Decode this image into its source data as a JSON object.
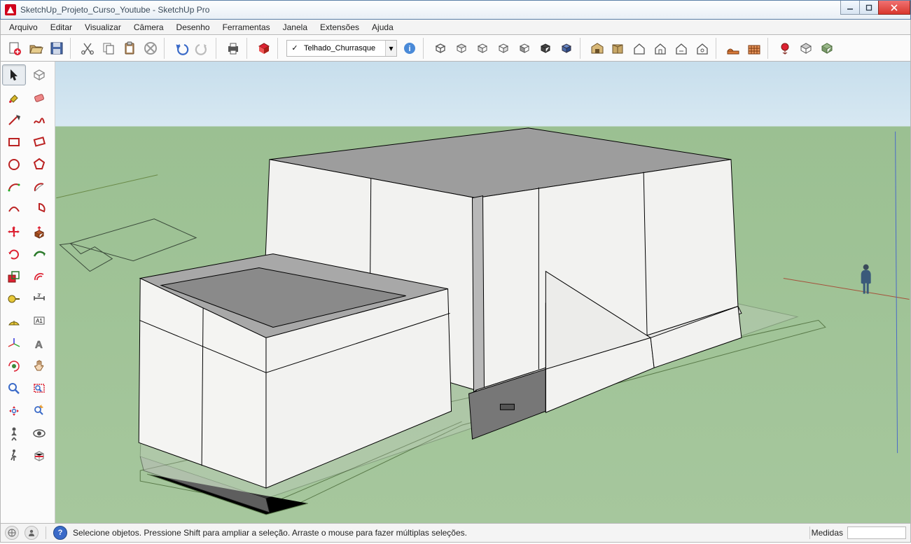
{
  "window": {
    "title": "SketchUp_Projeto_Curso_Youtube - SketchUp Pro"
  },
  "menu": {
    "items": [
      "Arquivo",
      "Editar",
      "Visualizar",
      "Câmera",
      "Desenho",
      "Ferramentas",
      "Janela",
      "Extensões",
      "Ajuda"
    ]
  },
  "layer_dropdown": {
    "value": "Telhado_Churrasque",
    "checked": "✓"
  },
  "status": {
    "hint": "Selecione objetos. Pressione Shift para ampliar a seleção. Arraste o mouse para fazer múltiplas seleções.",
    "measure_label": "Medidas"
  },
  "side_tools": [
    [
      "select-tool",
      "component-tool"
    ],
    [
      "paint-tool",
      "eraser-tool"
    ],
    [
      "line-tool",
      "freehand-tool"
    ],
    [
      "rectangle-tool",
      "rotated-rect-tool"
    ],
    [
      "circle-tool",
      "polygon-tool"
    ],
    [
      "arc-tool",
      "arc2-tool"
    ],
    [
      "arc3-tool",
      "pie-tool"
    ],
    [
      "move-tool",
      "pushpull-tool"
    ],
    [
      "rotate-tool",
      "followme-tool"
    ],
    [
      "scale-tool",
      "offset-tool"
    ],
    [
      "tape-tool",
      "dimension-tool"
    ],
    [
      "protractor-tool",
      "text-tool"
    ],
    [
      "axes-tool",
      "3dtext-tool"
    ],
    [
      "orbit-tool",
      "pan-tool"
    ],
    [
      "zoom-tool",
      "zoomwindow-tool"
    ],
    [
      "zoomextents-tool",
      "previous-tool"
    ],
    [
      "position-camera-tool",
      "lookaround-tool"
    ],
    [
      "walk-tool",
      "section-tool"
    ]
  ],
  "top_toolbar_groups": [
    [
      "new-file",
      "open-file",
      "save-file"
    ],
    [
      "cut",
      "copy",
      "paste",
      "delete"
    ],
    [
      "undo",
      "redo"
    ],
    [
      "print"
    ],
    [
      "model-info"
    ],
    [
      "layer-dropdown",
      "layer-manager"
    ],
    [
      "iso-view",
      "top-view",
      "front-view",
      "right-view",
      "back-view",
      "left-view",
      "shaded-view"
    ],
    [
      "3dwarehouse",
      "extension-warehouse",
      "house1",
      "house2",
      "house3",
      "house4"
    ],
    [
      "sandbox1",
      "sandbox2"
    ],
    [
      "geo1",
      "geo2",
      "geo3"
    ]
  ]
}
